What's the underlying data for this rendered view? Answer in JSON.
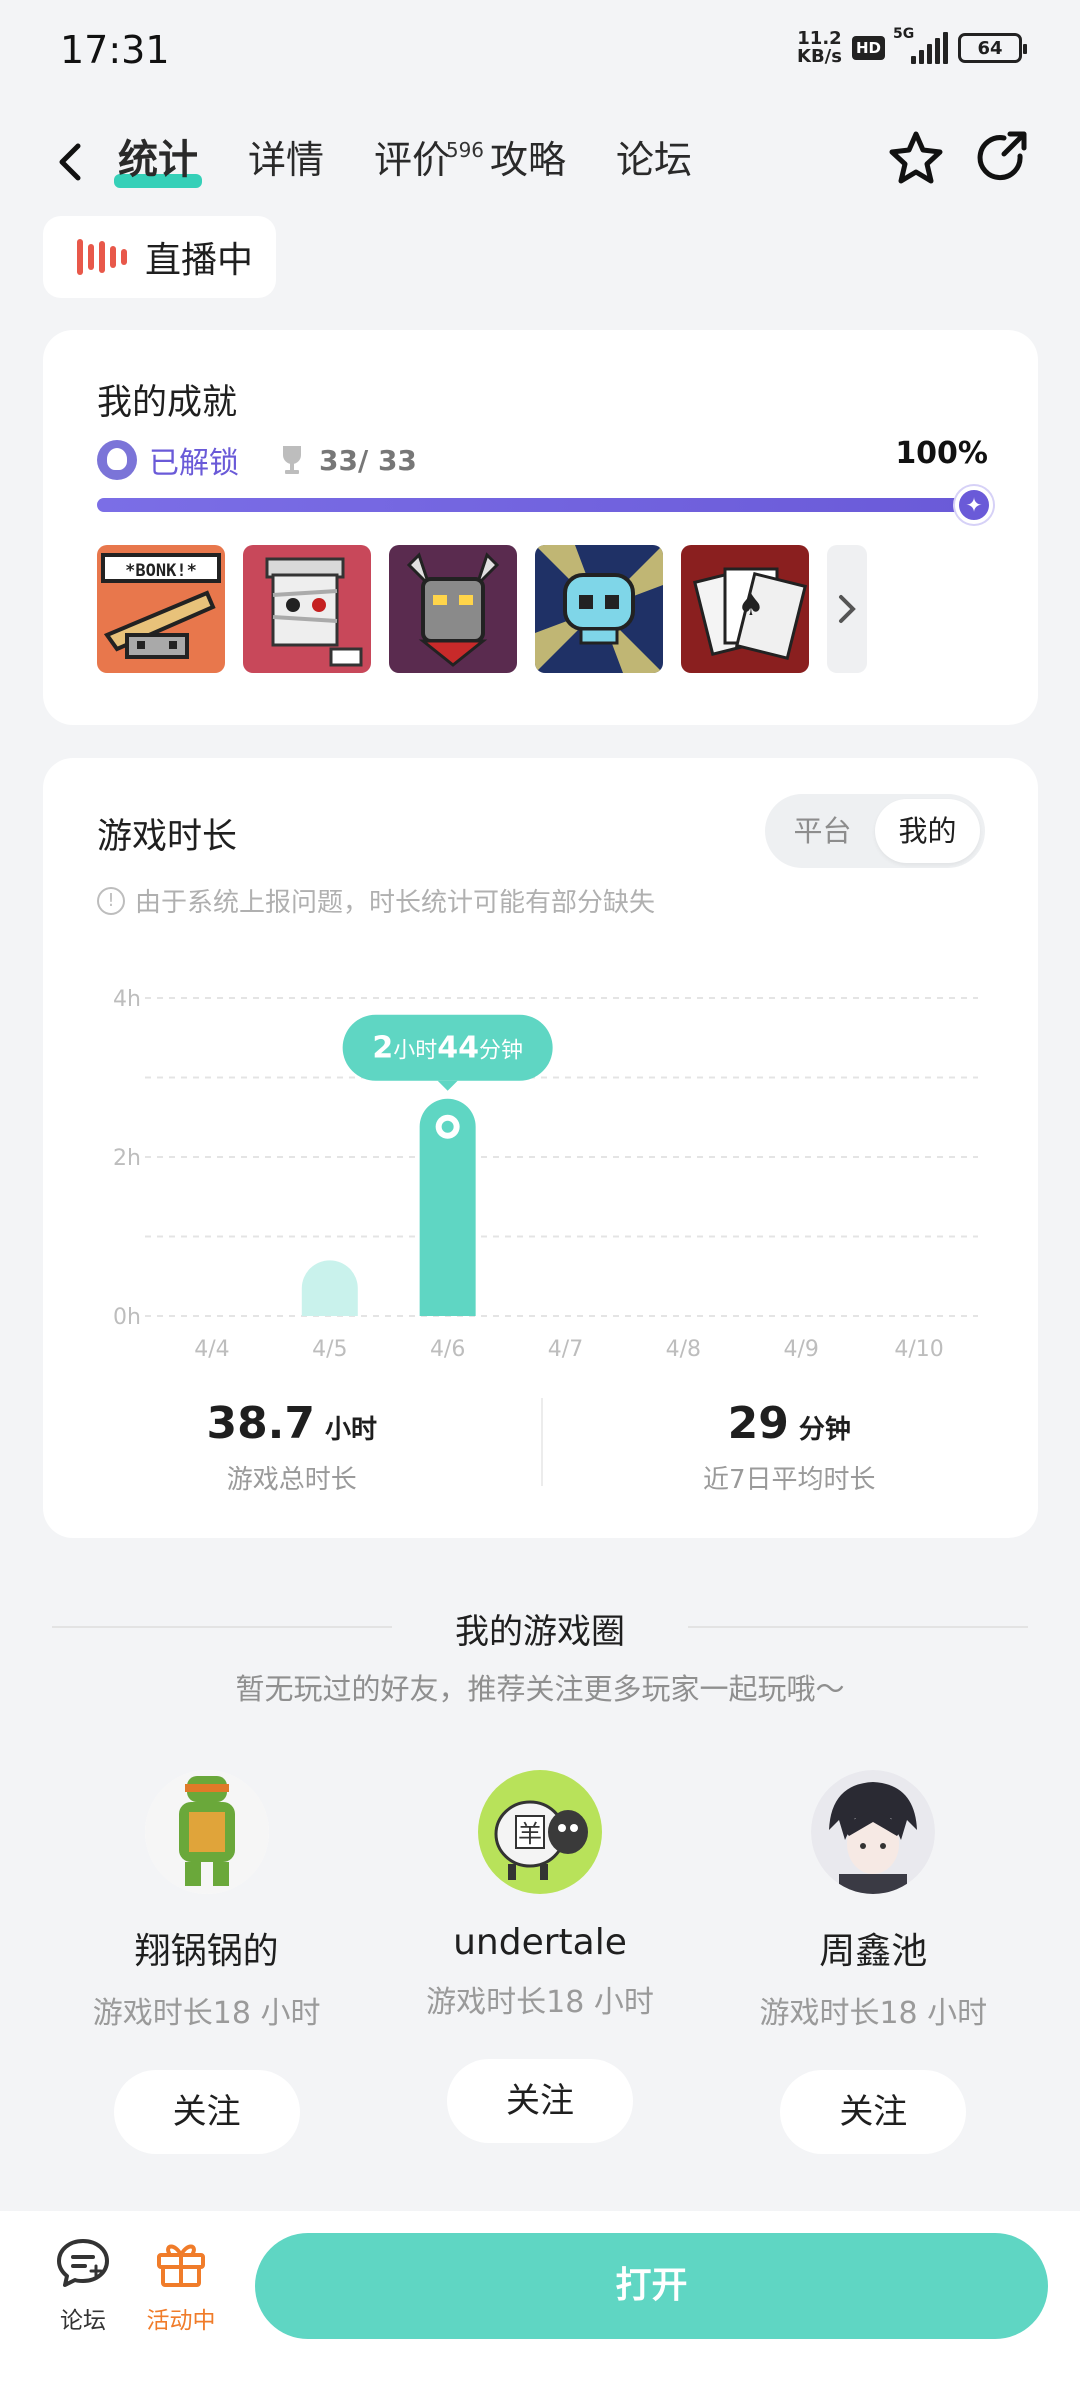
{
  "status": {
    "time": "17:31",
    "net_speed_top": "11.2",
    "net_speed_bottom": "KB/s",
    "hd": "HD",
    "network": "5G",
    "battery": "64"
  },
  "nav": {
    "tabs": [
      {
        "label": "统计",
        "active": true
      },
      {
        "label": "详情"
      },
      {
        "label": "评价",
        "badge": "596"
      },
      {
        "label": "攻略"
      },
      {
        "label": "论坛"
      }
    ]
  },
  "live": {
    "label": "直播中"
  },
  "achievements": {
    "title": "我的成就",
    "unlocked_label": "已解锁",
    "count": "33/ 33",
    "percent_label": "100%",
    "progress": 1.0,
    "badges": [
      "bonk-badge",
      "mummy-badge",
      "demon-badge",
      "skull-badge",
      "cards-badge"
    ]
  },
  "playtime": {
    "title": "游戏时长",
    "toggle": {
      "platform": "平台",
      "mine": "我的"
    },
    "notice": "由于系统上报问题，时长统计可能有部分缺失",
    "tooltip": {
      "hours": "2",
      "hours_unit": "小时",
      "minutes": "44",
      "minutes_unit": "分钟"
    },
    "total": {
      "value": "38.7",
      "unit": "小时",
      "label": "游戏总时长"
    },
    "average": {
      "value": "29",
      "unit": "分钟",
      "label": "近7日平均时长"
    }
  },
  "chart_data": {
    "type": "bar",
    "categories": [
      "4/4",
      "4/5",
      "4/6",
      "4/7",
      "4/8",
      "4/9",
      "4/10"
    ],
    "values": [
      0,
      0.7,
      2.733,
      0,
      0,
      0,
      0
    ],
    "ylim": [
      0,
      4
    ],
    "yticks": [
      "0h",
      "2h",
      "4h"
    ],
    "highlight_index": 2,
    "colors": {
      "bar": "#5fd6c3",
      "bar_light": "#c9f2ec"
    }
  },
  "circle": {
    "title": "我的游戏圈",
    "subtitle": "暂无玩过的好友，推荐关注更多玩家一起玩哦～",
    "friends": [
      {
        "name": "翔锅锅的",
        "time": "游戏时长18 小时",
        "follow": "关注"
      },
      {
        "name": "undertale",
        "time": "游戏时长18 小时",
        "follow": "关注"
      },
      {
        "name": "周鑫池",
        "time": "游戏时长18 小时",
        "follow": "关注"
      }
    ]
  },
  "bottom": {
    "forum": "论坛",
    "activity": "活动中",
    "open": "打开"
  },
  "colors": {
    "accent": "#5fd6c3",
    "purple": "#6a5ad8",
    "orange": "#f07c2a",
    "live_red": "#e8584a"
  }
}
